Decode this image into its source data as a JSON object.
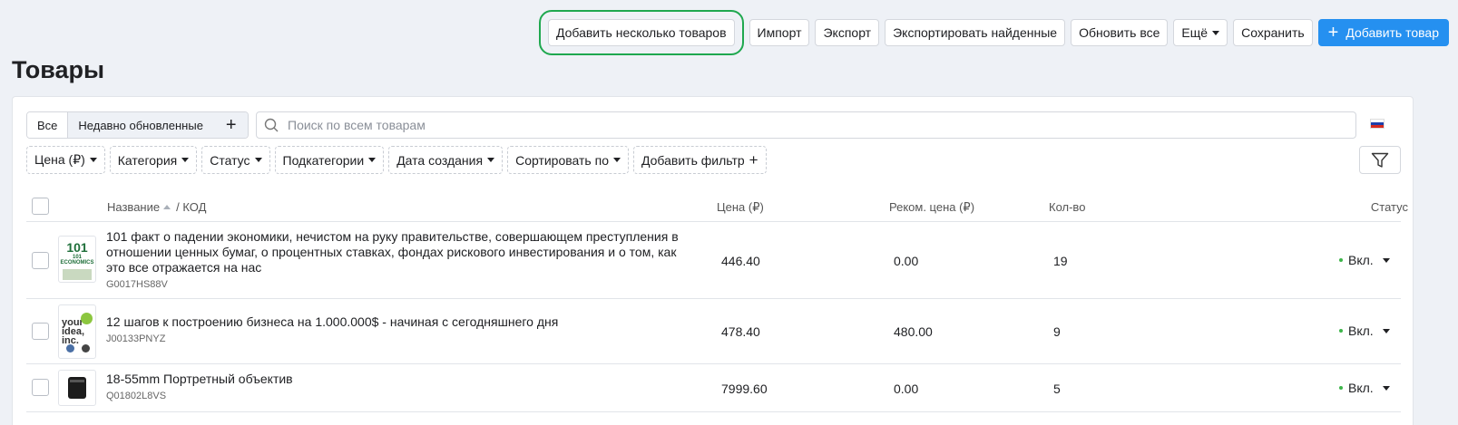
{
  "toolbar": {
    "add_multiple": "Добавить несколько товаров",
    "import": "Импорт",
    "export": "Экспорт",
    "export_found": "Экспортировать найденные",
    "update_all": "Обновить все",
    "more": "Ещё",
    "save": "Сохранить",
    "add_product": "Добавить товар"
  },
  "page_title": "Товары",
  "tabs": {
    "all": "Все",
    "recent": "Недавно обновленные"
  },
  "search": {
    "placeholder": "Поиск по всем товарам"
  },
  "filters": {
    "price": "Цена (₽)",
    "category": "Категория",
    "status": "Статус",
    "subcategories": "Подкатегории",
    "created": "Дата создания",
    "sort": "Сортировать по",
    "add_filter": "Добавить фильтр"
  },
  "columns": {
    "name": "Название",
    "code": "/  КОД",
    "price": "Цена (₽)",
    "rec_price": "Реком. цена (₽)",
    "qty": "Кол-во",
    "status": "Статус"
  },
  "rows": [
    {
      "name": "101 факт о падении экономики, нечистом на руку правительстве, совершающем преступления в отношении ценных бумаг, о процентных ставках, фондах рискового инвестирования и о том, как это все отражается на нас",
      "sku": "G0017HS88V",
      "price": "446.40",
      "rec_price": "0.00",
      "qty": "19",
      "status": "Вкл.",
      "thumb_text": "101 ECONOMICS"
    },
    {
      "name": "12 шагов к построению бизнеса на 1.000.000$ - начиная с сегодняшнего дня",
      "sku": "J00133PNYZ",
      "price": "478.40",
      "rec_price": "480.00",
      "qty": "9",
      "status": "Вкл.",
      "thumb_text": "your idea, inc."
    },
    {
      "name": "18-55mm Портретный объектив",
      "sku": "Q01802L8VS",
      "price": "7999.60",
      "rec_price": "0.00",
      "qty": "5",
      "status": "Вкл.",
      "thumb_text": ""
    }
  ],
  "colors": {
    "primary": "#2590f0",
    "highlight": "#1fa84f",
    "status_on": "#3db54a"
  }
}
